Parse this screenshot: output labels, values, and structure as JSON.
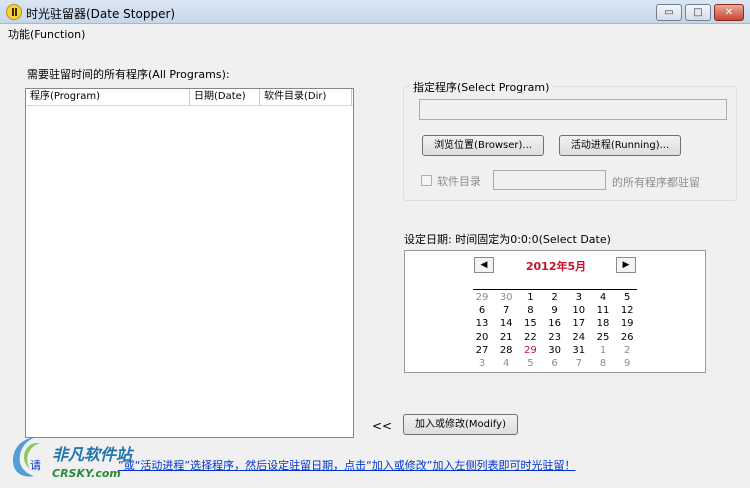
{
  "window": {
    "title": "时光驻留器(Date Stopper)",
    "controls": {
      "minimize": "▭",
      "maximize": "□",
      "close": "✕"
    }
  },
  "menu": {
    "function": "功能(Function)"
  },
  "programs": {
    "label": "需要驻留时间的所有程序(All Programs):",
    "columns": [
      "程序(Program)",
      "日期(Date)",
      "软件目录(Dir)"
    ]
  },
  "select_program": {
    "title": "指定程序(Select Program)",
    "path_value": "",
    "browse_button": "浏览位置(Browser)...",
    "running_button": "活动进程(Running)...",
    "dir_checkbox_label": "软件目录",
    "dir_value": "",
    "dir_suffix": "的所有程序都驻留"
  },
  "date": {
    "label": "设定日期: 时间固定为0:0:0(Select Date)",
    "calendar": {
      "month": "2012年5月",
      "prev": "◀",
      "next": "▶",
      "weeks": [
        [
          {
            "d": "29",
            "o": true
          },
          {
            "d": "30",
            "o": true
          },
          {
            "d": "1"
          },
          {
            "d": "2"
          },
          {
            "d": "3"
          },
          {
            "d": "4"
          },
          {
            "d": "5"
          }
        ],
        [
          {
            "d": "6"
          },
          {
            "d": "7"
          },
          {
            "d": "8"
          },
          {
            "d": "9"
          },
          {
            "d": "10"
          },
          {
            "d": "11"
          },
          {
            "d": "12"
          }
        ],
        [
          {
            "d": "13"
          },
          {
            "d": "14"
          },
          {
            "d": "15"
          },
          {
            "d": "16"
          },
          {
            "d": "17"
          },
          {
            "d": "18"
          },
          {
            "d": "19"
          }
        ],
        [
          {
            "d": "20"
          },
          {
            "d": "21"
          },
          {
            "d": "22"
          },
          {
            "d": "23"
          },
          {
            "d": "24"
          },
          {
            "d": "25"
          },
          {
            "d": "26"
          }
        ],
        [
          {
            "d": "27"
          },
          {
            "d": "28"
          },
          {
            "d": "29",
            "t": true
          },
          {
            "d": "30"
          },
          {
            "d": "31"
          },
          {
            "d": "1",
            "o": true
          },
          {
            "d": "2",
            "o": true
          }
        ],
        [
          {
            "d": "3",
            "o": true
          },
          {
            "d": "4",
            "o": true
          },
          {
            "d": "5",
            "o": true
          },
          {
            "d": "6",
            "o": true
          },
          {
            "d": "7",
            "o": true
          },
          {
            "d": "8",
            "o": true
          },
          {
            "d": "9",
            "o": true
          }
        ]
      ]
    }
  },
  "actions": {
    "arrow": "<<",
    "modify_button": "加入或修改(Modify)"
  },
  "footer": {
    "hint_prefix": "请",
    "hint": "”或“活动进程”选择程序，然后设定驻留日期，点击“加入或修改”加入左侧列表即可时光驻留！"
  },
  "watermark": {
    "main": "非凡软件站",
    "sub": "CRSKY.com"
  },
  "colors": {
    "title_gradient_top": "#dbe6f3",
    "accent_red": "#c8102e",
    "link_blue": "#0033cc"
  }
}
